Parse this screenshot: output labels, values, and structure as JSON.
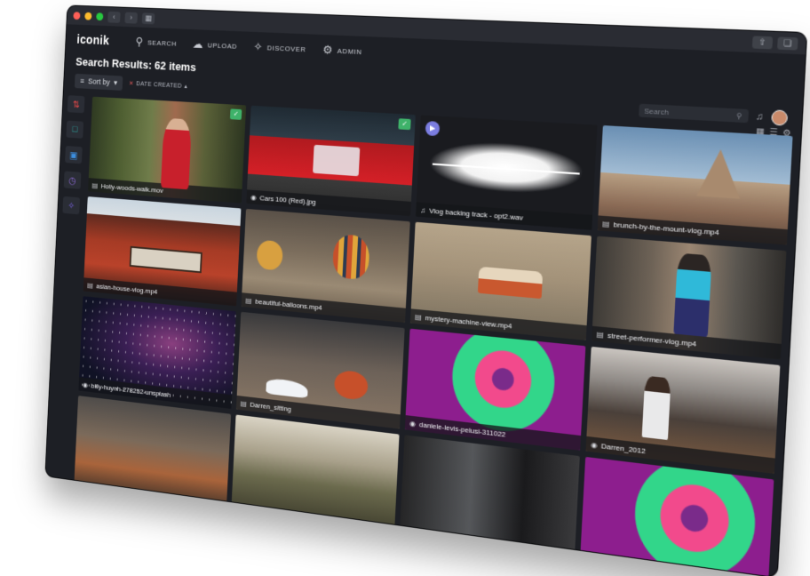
{
  "app": {
    "logo": "iconik",
    "nav": [
      {
        "label": "SEARCH",
        "icon": "search-icon"
      },
      {
        "label": "UPLOAD",
        "icon": "cloud-upload-icon"
      },
      {
        "label": "DISCOVER",
        "icon": "discover-icon"
      },
      {
        "label": "ADMIN",
        "icon": "gear-icon"
      }
    ]
  },
  "results": {
    "title": "Search Results: 62 items",
    "sort_label": "Sort by",
    "filter_chip": "DATE CREATED",
    "search_placeholder": "Search"
  },
  "tiles": [
    {
      "name": "Holly-woods-walk.mov",
      "type": "video",
      "badge": true
    },
    {
      "name": "Cars 100 (Red).jpg",
      "type": "image",
      "badge": true
    },
    {
      "name": "Vlog backing track - opt2.wav",
      "type": "audio",
      "badge": false
    },
    {
      "name": "brunch-by-the-mount-vlog.mp4",
      "type": "video",
      "badge": false
    },
    {
      "name": "asian-house-vlog.mp4",
      "type": "video",
      "badge": false
    },
    {
      "name": "beautiful-balloons.mp4",
      "type": "video",
      "badge": false
    },
    {
      "name": "mystery-machine-view.mp4",
      "type": "video",
      "badge": false
    },
    {
      "name": "street-performer-vlog.mp4",
      "type": "video",
      "badge": false
    },
    {
      "name": "billy-huynh-278252-unsplash",
      "type": "image",
      "badge": false
    },
    {
      "name": "Darren_sitting",
      "type": "video",
      "badge": false
    },
    {
      "name": "daniele-levis-pelusi-311022",
      "type": "image",
      "badge": false
    },
    {
      "name": "Darren_2012",
      "type": "image",
      "badge": false
    }
  ],
  "colors": {
    "background": "#1d1f25",
    "accent_green": "#3fb26a",
    "accent_red": "#e84a4a"
  }
}
